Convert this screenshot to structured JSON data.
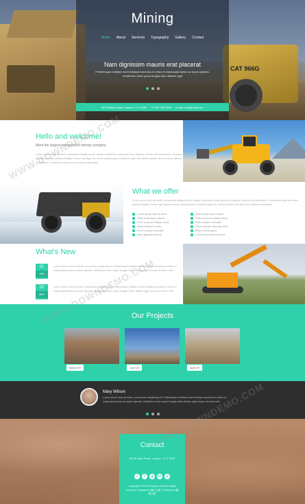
{
  "hero": {
    "title": "Mining",
    "nav": [
      {
        "label": "Home",
        "active": true
      },
      {
        "label": "About",
        "active": false
      },
      {
        "label": "Services",
        "active": false
      },
      {
        "label": "Typography",
        "active": false
      },
      {
        "label": "Gallery",
        "active": false
      },
      {
        "label": "Contact",
        "active": false
      }
    ],
    "tagline": "Nam dignissim mauris erat placerat",
    "subtitle": "Pellentesque habitant morbi tristique senectus et netus et malesuada fames ac turpis egestas. Vestibulum tortor quam feugiat vitae ultricies eget",
    "truck_label": "CAT 966G",
    "info": [
      "85 St Mary Road, London, +1 0 1000",
      "+0 000 000 0000",
      "e-mail: mail@mail.com"
    ]
  },
  "welcome": {
    "title": "Hello and welcome!",
    "subtitle": "Meet the largest independent mining company",
    "body": "Lorem ipsum dolor sit amet, consectetur adipiscing elit. Integer vestibulum purus quis lacus aliquam, lobortis nisl elementum. Vivamus ac justo nec diam pretium fringilla. Donec eget ligula ac metus pellentesque tincidunt id eget nisl. Nullam iaculis nibh sed lacus ultrices consectetur. Curabitur id neque ut arcu luctus malesuada."
  },
  "offer": {
    "title": "What we offer",
    "body": "Lorem ipsum dolor sit amet, consectetur adipiscing elit. Integer vestibulum purus quis lacus aliquam, lobortis nisl elementum. Vivamus ac justo nec diam pretium fringilla. Donec eget ligula ac metus pellentesque tincidunt id eget nisl. Nullam iaculis nibh sed lacus ultrices consectetur.",
    "list_left": [
      "Lorem ipsum dolor sit amet",
      "Morbi scelerisque viverra",
      "Proin ac ipsum tristique lacus",
      "Nulla tincidunt ut nulla",
      "Fusce suscipit venenatis",
      "Nam dignissim mauris"
    ],
    "list_right": [
      "Morbi mollis risus id lacus",
      "Proin ac ipsum tristique lacus",
      "Nulla suscipit venenatis",
      "Fusce suscipit venenatis risus",
      "Etiam viverra ipsum",
      "Lorem ipsum dolor sit amet"
    ]
  },
  "news": {
    "title": "What's New",
    "items": [
      {
        "day": "01",
        "month": "JAN",
        "text": "Lorem ipsum dolor sit amet, consectetur adipiscing elit. Pellentesque habitant morbi tristique senectus et netus et malesuada fames ac turpis egestas. Vestibulum tortor quam, feugiat vitae, ultricies eget, tempor sit amet, ante."
      },
      {
        "day": "02",
        "month": "MAY",
        "text": "Lorem ipsum dolor sit amet, consectetur adipiscing elit. Pellentesque habitant morbi tristique senectus et netus et malesuada fames ac turpis egestas. Vestibulum tortor quam, feugiat vitae, ultricies eget, tempor sit amet, ante."
      }
    ]
  },
  "projects": {
    "title": "Our Projects",
    "items": [
      {
        "date": "March 09"
      },
      {
        "date": "June 24"
      },
      {
        "date": "April 09"
      }
    ]
  },
  "testimonial": {
    "name": "Mary Wilson",
    "text": "Lorem ipsum dolor sit amet, consectetur adipiscing elit. Pellentesque habitant morbi tristique senectus et netus et malesuada fames ac turpis egestas. Vestibulum tortor quam feugiat vitae ultricies eget tempor sit amet ante."
  },
  "contact": {
    "title": "Contact",
    "address": "85 St Mary Road, London, +1 0 7032",
    "social": [
      "t",
      "f",
      "g",
      "in",
      "p"
    ],
    "footer": "Copyright © 2015 Company name All rights reserved. Template by 懒人之家. Collect from 模板之家"
  },
  "watermark": "WWW.DOWNDEMO.COM",
  "colors": {
    "accent": "#2fd1aa",
    "dark": "#2e2e2e"
  }
}
